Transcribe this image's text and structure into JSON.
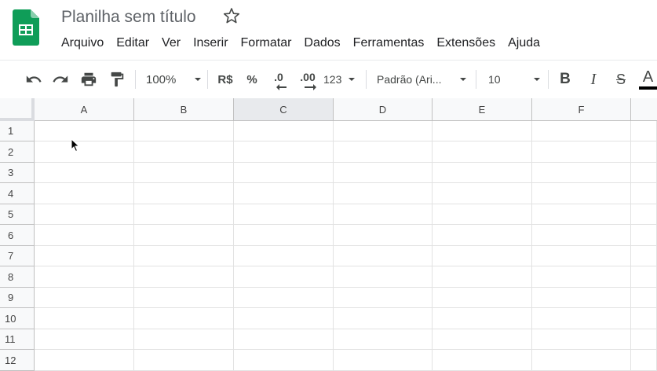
{
  "app": {
    "doc_title": "Planilha sem título",
    "logo_icon": "google-sheets-logo",
    "brand_color": "#0f9d58"
  },
  "menu": [
    "Arquivo",
    "Editar",
    "Ver",
    "Inserir",
    "Formatar",
    "Dados",
    "Ferramentas",
    "Extensões",
    "Ajuda"
  ],
  "toolbar": {
    "zoom": "100%",
    "currency": "R$",
    "percent": "%",
    "decimal_decrease": ".0",
    "decimal_increase": ".00",
    "number_format": "123",
    "font_family": "Padrão (Ari...",
    "font_size": "10",
    "bold": "B",
    "italic": "I",
    "strike": "S",
    "text_color_label": "A"
  },
  "sheet": {
    "columns": [
      "A",
      "B",
      "C",
      "D",
      "E",
      "F"
    ],
    "selected_column": "C",
    "rows": [
      "1",
      "2",
      "3",
      "4",
      "5",
      "6",
      "7",
      "8",
      "9",
      "10",
      "11",
      "12"
    ]
  }
}
